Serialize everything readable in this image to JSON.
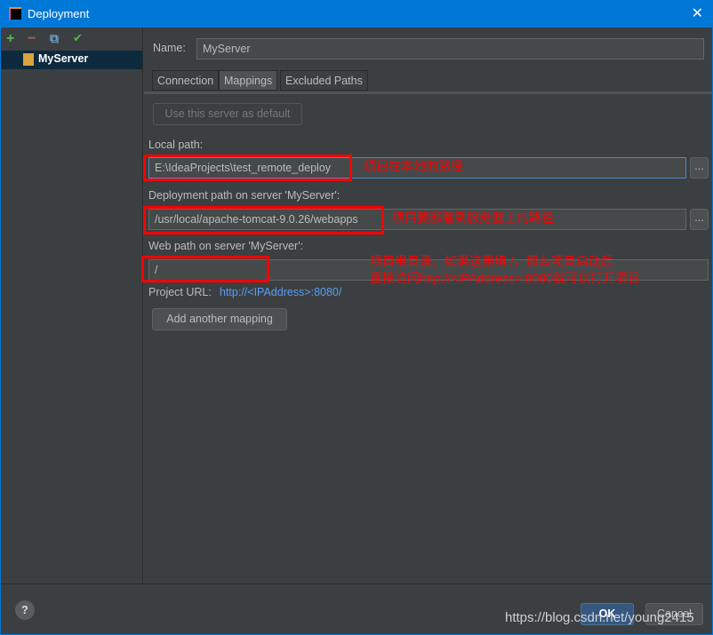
{
  "window": {
    "title": "Deployment",
    "close": "✕"
  },
  "sidebar": {
    "toolbar": {
      "add": "+",
      "remove": "−",
      "copy": "⧉",
      "check": "✔"
    },
    "items": [
      {
        "label": "MyServer"
      }
    ]
  },
  "form": {
    "name_label": "Name:",
    "name_value": "MyServer",
    "tabs": [
      {
        "label": "Connection"
      },
      {
        "label": "Mappings",
        "selected": true
      },
      {
        "label": "Excluded Paths"
      }
    ],
    "default_button": "Use this server as default",
    "local_path_label": "Local path:",
    "local_path_value": "E:\\IdeaProjects\\test_remote_deploy",
    "deploy_path_label": "Deployment path on server 'MyServer':",
    "deploy_path_value": "/usr/local/apache-tomcat-9.0.26/webapps",
    "web_path_label": "Web path on server 'MyServer':",
    "web_path_value": "/",
    "project_url_label": "Project URL:",
    "project_url_value": "http://<IPAddress>:8080/",
    "add_mapping": "Add another mapping",
    "browse": "..."
  },
  "annotations": {
    "local": "项目在本地的路径",
    "deploy": "项目要部署到服务器上的路径",
    "web_line1": "项目根目录，如果这里填 /，那么项目启动后",
    "web_line2": "直接访问http://<IPAddress>:8080就可以打开项目",
    "color": "#ff0000"
  },
  "footer": {
    "help": "?",
    "ok": "OK",
    "cancel": "Cancel"
  },
  "watermark": "https://blog.csdn.net/young2415"
}
